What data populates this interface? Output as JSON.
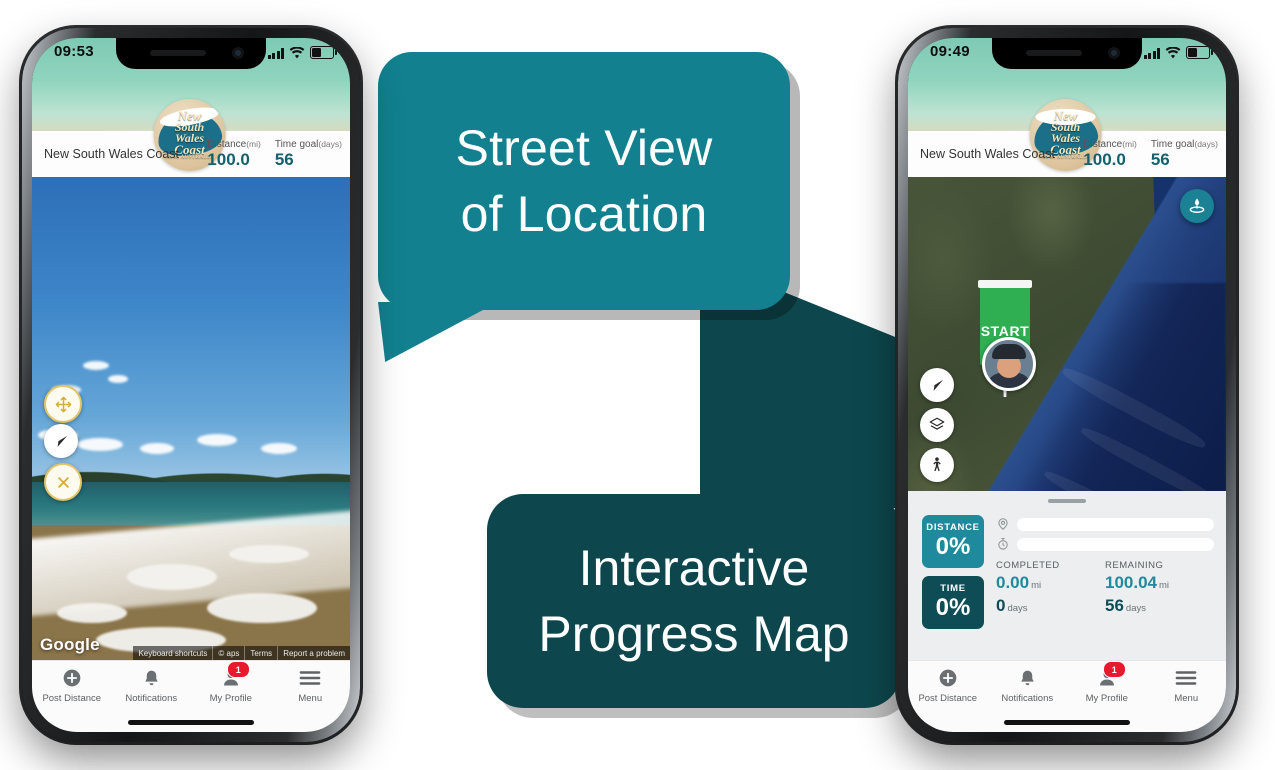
{
  "callouts": [
    {
      "id": "street-view",
      "line1": "Street View",
      "line2": "of Location",
      "color": "#12808f"
    },
    {
      "id": "progress-map",
      "line1": "Interactive",
      "line2": "Progress Map",
      "color": "#0d474d"
    }
  ],
  "phone_left": {
    "status": {
      "time": "09:53",
      "signal_icon": "cellular-bars-icon",
      "wifi_icon": "wifi-icon",
      "battery_icon": "battery-icon"
    },
    "header": {
      "title": "New South Wales Coast",
      "logo_text": [
        "New",
        "South",
        "Wales",
        "Coast",
        "NSW, AUSTRALIA"
      ],
      "stats": [
        {
          "label": "Distance",
          "unit": "(mi)",
          "value": "100.0"
        },
        {
          "label": "Time goal",
          "unit": "(days)",
          "value": "56"
        }
      ]
    },
    "streetview": {
      "controls": [
        {
          "name": "pan-move-button",
          "icon": "move-arrows-icon"
        },
        {
          "name": "navigate-button",
          "icon": "navigation-arrow-icon"
        },
        {
          "name": "close-streetview-button",
          "icon": "close-x-icon"
        }
      ],
      "watermark": "Google",
      "attribution": [
        "Keyboard shortcuts",
        "© aps",
        "Terms",
        "Report a problem"
      ]
    }
  },
  "phone_right": {
    "status": {
      "time": "09:49",
      "signal_icon": "cellular-bars-icon",
      "wifi_icon": "wifi-icon",
      "battery_icon": "battery-icon"
    },
    "header": {
      "title": "New South Wales Coast",
      "logo_text": [
        "New",
        "South",
        "Wales",
        "Coast",
        "NSW, AUSTRALIA"
      ],
      "stats": [
        {
          "label": "Distance",
          "unit": "(mi)",
          "value": "100.0"
        },
        {
          "label": "Time goal",
          "unit": "(days)",
          "value": "56"
        }
      ]
    },
    "map": {
      "marker_label": "START",
      "drop_pin_button": "drop-pin-icon",
      "controls": [
        {
          "name": "my-location-button",
          "icon": "navigation-arrow-icon"
        },
        {
          "name": "map-layers-button",
          "icon": "layers-icon"
        },
        {
          "name": "street-view-pegman-button",
          "icon": "pegman-icon"
        }
      ]
    },
    "sheet": {
      "tiles": [
        {
          "label": "DISTANCE",
          "value": "0%",
          "color": "#1f8a9d"
        },
        {
          "label": "TIME",
          "value": "0%",
          "color": "#0f4d56"
        }
      ],
      "bars": [
        {
          "icon": "map-pin-icon",
          "percent": 0
        },
        {
          "icon": "stopwatch-icon",
          "percent": 0
        }
      ],
      "columns": [
        {
          "heading": "COMPLETED",
          "distance": "0.00",
          "distance_unit": "mi",
          "days": "0",
          "days_unit": "days"
        },
        {
          "heading": "REMAINING",
          "distance": "100.04",
          "distance_unit": "mi",
          "days": "56",
          "days_unit": "days"
        }
      ]
    }
  },
  "nav": {
    "items": [
      {
        "label": "Post Distance",
        "icon": "plus-circle-icon",
        "badge": null
      },
      {
        "label": "Notifications",
        "icon": "bell-icon",
        "badge": null
      },
      {
        "label": "My Profile",
        "icon": "person-icon",
        "badge": "1"
      },
      {
        "label": "Menu",
        "icon": "hamburger-menu-icon",
        "badge": null
      }
    ]
  }
}
